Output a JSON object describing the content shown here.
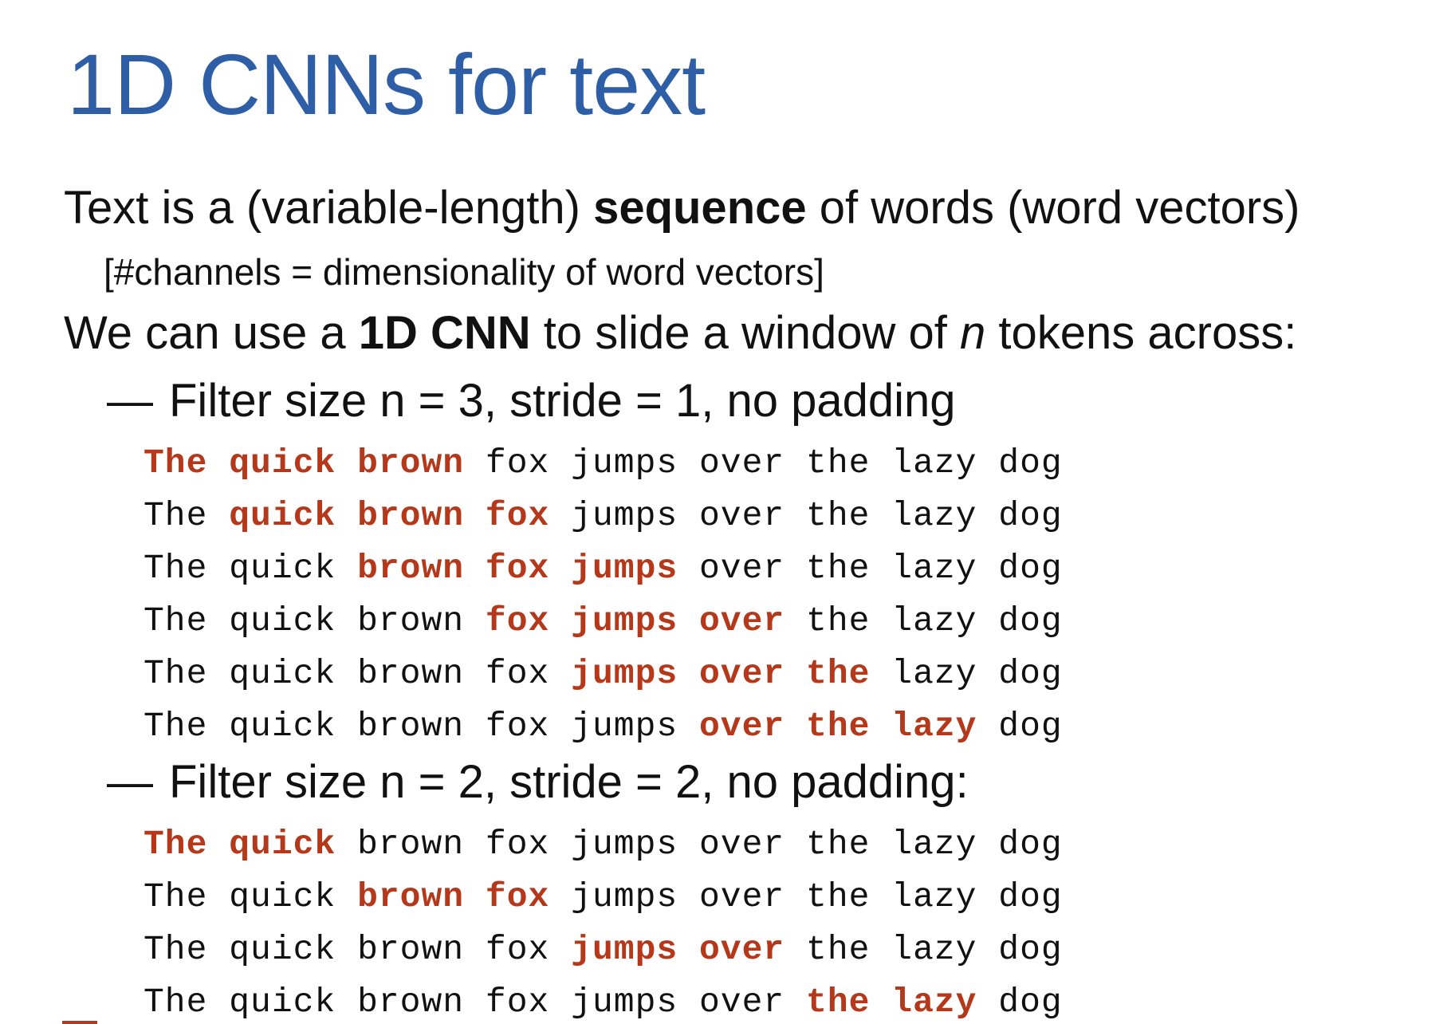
{
  "title": "1D CNNs for text",
  "colors": {
    "title": "#2e5ea6",
    "highlight": "#b5381a",
    "text": "#111111"
  },
  "bullet1": {
    "before": "Text is a (variable-length) ",
    "bold": "sequence",
    "after": " of words (word vectors)"
  },
  "bullet1_note": "[#channels = dimensionality of word vectors]",
  "bullet2": {
    "before": "We can use a ",
    "bold": "1D CNN",
    "middle": " to slide a window of ",
    "italic": "n",
    "after": " tokens across:"
  },
  "dash": "—",
  "sentence": [
    "The",
    "quick",
    "brown",
    "fox",
    "jumps",
    "over",
    "the",
    "lazy",
    "dog"
  ],
  "sections": [
    {
      "label": "Filter size n = 3, stride = 1, no padding",
      "windows": [
        [
          0,
          1,
          2
        ],
        [
          1,
          2,
          3
        ],
        [
          2,
          3,
          4
        ],
        [
          3,
          4,
          5
        ],
        [
          4,
          5,
          6
        ],
        [
          5,
          6,
          7
        ]
      ]
    },
    {
      "label": "Filter size n = 2, stride = 2, no padding:",
      "windows": [
        [
          0,
          1
        ],
        [
          2,
          3
        ],
        [
          4,
          5
        ],
        [
          6,
          7
        ]
      ]
    }
  ]
}
